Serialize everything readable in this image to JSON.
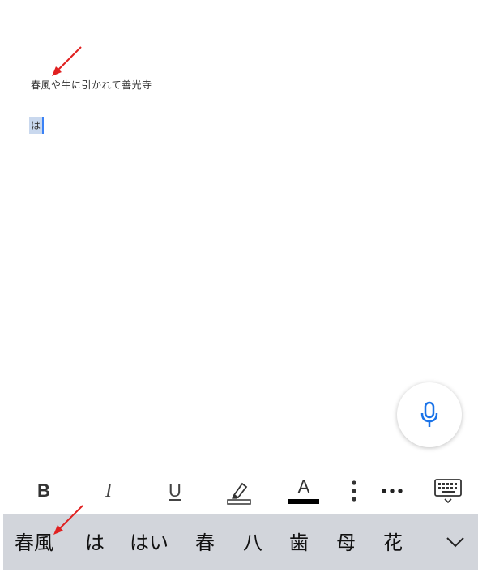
{
  "document": {
    "line1": "春風や牛に引かれて善光寺",
    "composing_text": "は"
  },
  "formatting_toolbar": {
    "bold_label": "B",
    "italic_label": "I",
    "underline_label": "U",
    "text_color_label": "A",
    "icons": [
      "highlighter-icon",
      "vertical-dots-icon",
      "more-icon",
      "keyboard-icon"
    ]
  },
  "keyboard": {
    "candidates": [
      "春風",
      "は",
      "はい",
      "春",
      "八",
      "歯",
      "母",
      "花"
    ]
  },
  "colors": {
    "accent": "#1a73e8",
    "arrow": "#e02020",
    "composing_highlight": "#c9d8ee",
    "candidate_bar": "#d2d5db"
  }
}
